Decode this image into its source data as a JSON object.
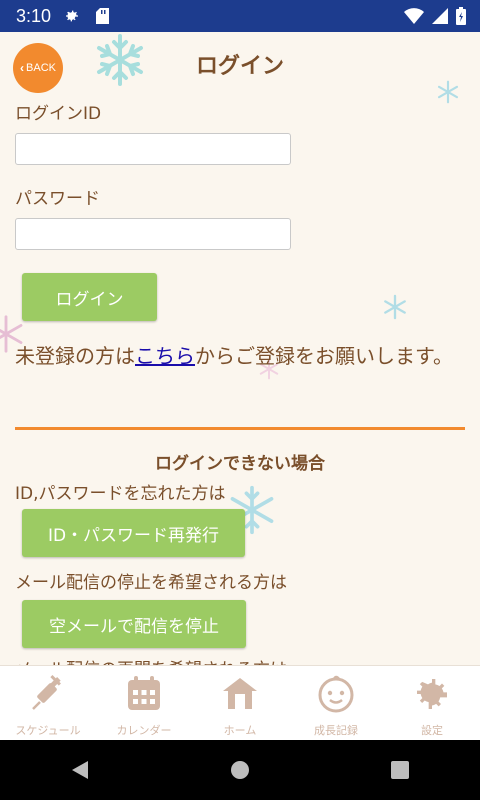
{
  "status_bar": {
    "time": "3:10"
  },
  "header": {
    "back_label": "BACK",
    "title": "ログイン"
  },
  "login_form": {
    "id_label": "ログインID",
    "id_value": "",
    "password_label": "パスワード",
    "password_value": "",
    "login_button": "ログイン"
  },
  "register": {
    "prefix": "未登録の方は",
    "link": "こちら",
    "suffix": "からご登録をお願いします。"
  },
  "help": {
    "title": "ログインできない場合",
    "forgot_text": "ID,パスワードを忘れた方は",
    "reissue_button": "ID・パスワード再発行",
    "stop_text": "メール配信の停止を希望される方は",
    "stop_button": "空メールで配信を停止",
    "resume_text": "メール配信の再開を希望される方は"
  },
  "bottom_nav": [
    {
      "label": "スケジュール",
      "icon": "syringe-icon"
    },
    {
      "label": "カレンダー",
      "icon": "calendar-icon"
    },
    {
      "label": "ホーム",
      "icon": "home-icon"
    },
    {
      "label": "成長記録",
      "icon": "baby-face-icon"
    },
    {
      "label": "設定",
      "icon": "gear-icon"
    }
  ],
  "colors": {
    "accent": "#f28a2e",
    "button": "#9ccb63",
    "text": "#7a4f2b",
    "nav_icon": "#d2b7a6",
    "status_bar": "#1d3c8e"
  }
}
